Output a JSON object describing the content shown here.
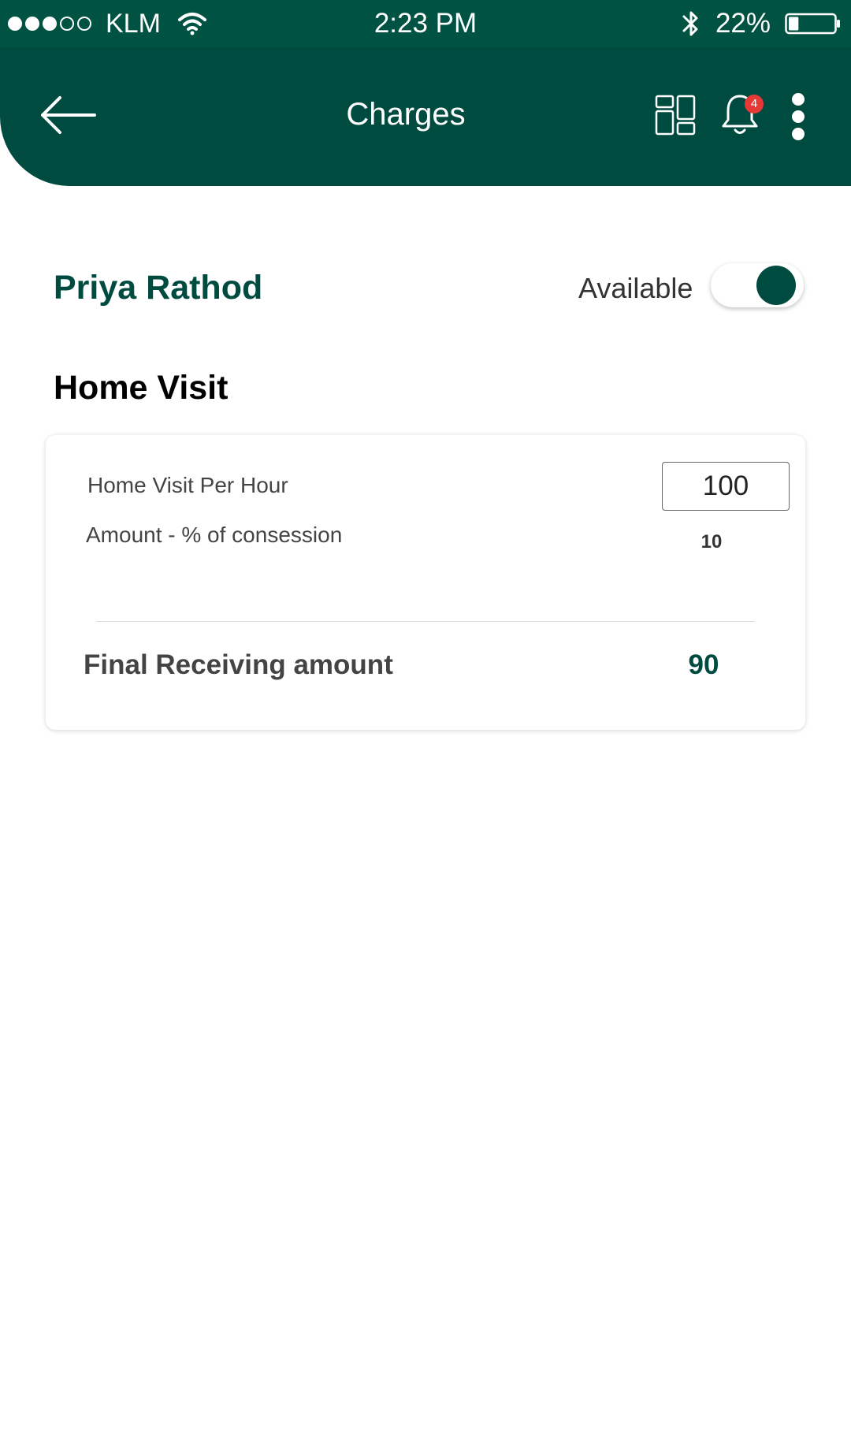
{
  "status_bar": {
    "carrier": "KLM",
    "time": "2:23 PM",
    "battery_percent": "22%",
    "battery_level": 0.22,
    "signal_bars_filled": 3,
    "signal_bars_total": 5,
    "icons": [
      "wifi-icon",
      "bluetooth-icon",
      "battery-icon"
    ]
  },
  "header": {
    "title": "Charges",
    "notification_count": "4",
    "icons": [
      "back-arrow-icon",
      "grid-icon",
      "bell-icon",
      "more-vertical-icon"
    ]
  },
  "profile": {
    "name": "Priya Rathod",
    "availability_label": "Available",
    "available": true
  },
  "section": {
    "title": "Home Visit"
  },
  "card": {
    "rate_label": "Home Visit Per Hour",
    "rate_value": "100",
    "concession_label": "Amount - % of consession",
    "concession_value": "10",
    "final_label": "Final Receiving amount",
    "final_value": "90"
  },
  "colors": {
    "primary": "#004b40",
    "status_bar": "#005243",
    "badge": "#e53935"
  }
}
